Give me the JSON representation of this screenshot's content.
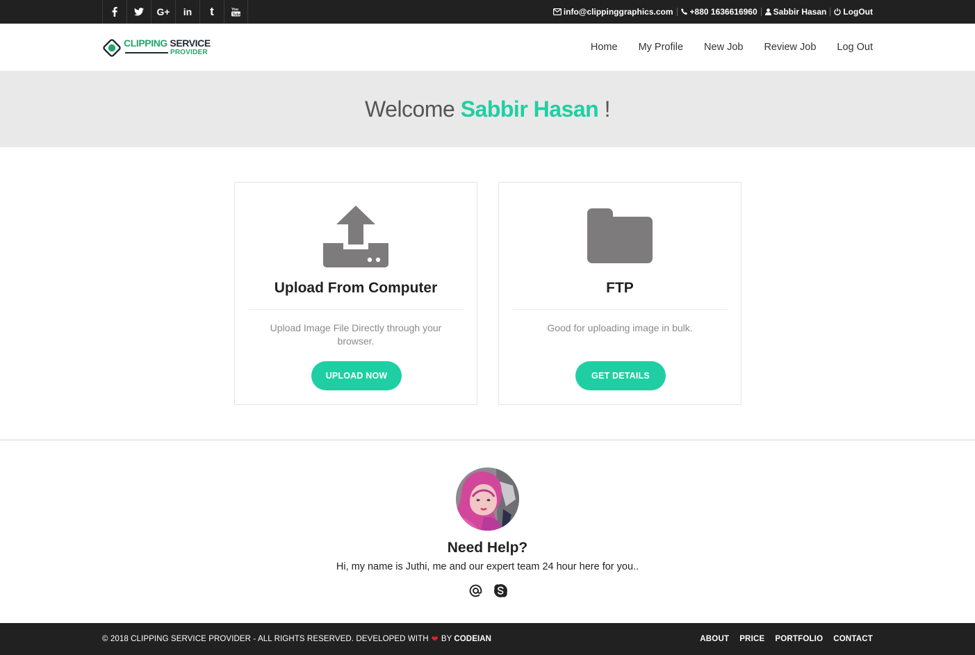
{
  "topbar": {
    "social": [
      {
        "icon": "facebook-icon",
        "glyph": "f"
      },
      {
        "icon": "twitter-icon",
        "glyph": ""
      },
      {
        "icon": "google-plus-icon",
        "glyph": "G+"
      },
      {
        "icon": "linkedin-icon",
        "glyph": "in"
      },
      {
        "icon": "tumblr-icon",
        "glyph": "t"
      },
      {
        "icon": "youtube-icon",
        "glyph": ""
      }
    ],
    "email": "info@clippinggraphics.com",
    "phone": "+880 1636616960",
    "user": "Sabbir Hasan",
    "logout": "LogOut"
  },
  "navbar": {
    "logo": {
      "line1_a": "CLIPPING",
      "line1_b": " SERVICE",
      "line2": "PROVIDER"
    },
    "links": [
      "Home",
      "My Profile",
      "New Job",
      "Review Job",
      "Log Out"
    ]
  },
  "banner": {
    "prefix": "Welcome ",
    "name": "Sabbir Hasan",
    "suffix": " !"
  },
  "cards": [
    {
      "icon": "upload-icon",
      "title": "Upload From Computer",
      "description": "Upload Image File Directly through your browser.",
      "button": "UPLOAD NOW"
    },
    {
      "icon": "folder-icon",
      "title": "FTP",
      "description": "Good for uploading image in bulk.",
      "button": "GET DETAILS"
    }
  ],
  "help": {
    "title": "Need Help?",
    "text": "Hi, my name is Juthi, me and our expert team 24 hour here for you..",
    "icons": [
      "at-icon",
      "skype-icon"
    ]
  },
  "footer": {
    "copyright": "© 2018 CLIPPING SERVICE PROVIDER - ALL RIGHTS RESERVED. DEVELOPED WITH",
    "by": "BY",
    "developer": "CODEIAN",
    "links": [
      "ABOUT",
      "PRICE",
      "PORTFOLIO",
      "CONTACT"
    ]
  },
  "colors": {
    "accent": "#1fcfa3",
    "dark_bar": "#212121",
    "banner_bg": "#e9e9e9",
    "icon_gray": "#7d7b7c",
    "heart": "#e4222f"
  }
}
